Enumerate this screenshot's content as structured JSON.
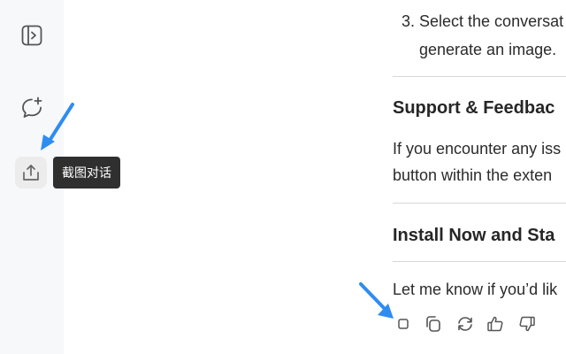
{
  "sidebar": {
    "items": [
      {
        "icon": "sidebar-toggle-icon"
      },
      {
        "icon": "new-chat-icon"
      },
      {
        "icon": "share-upload-icon",
        "active": true
      }
    ]
  },
  "tooltip": {
    "text": "截图对话"
  },
  "content": {
    "step": {
      "number": "3.",
      "line1": "Select the conversat",
      "line2": "generate an image."
    },
    "support": {
      "heading": "Support & Feedbac",
      "line1": "If you encounter any iss",
      "line2": "button within the exten"
    },
    "install": {
      "heading": "Install Now and Sta"
    },
    "closing": {
      "text": "Let me know if you’d lik"
    }
  },
  "actions": [
    {
      "icon": "stop-icon"
    },
    {
      "icon": "copy-icon"
    },
    {
      "icon": "regenerate-icon"
    },
    {
      "icon": "thumbs-up-icon"
    },
    {
      "icon": "thumbs-down-icon"
    }
  ],
  "colors": {
    "sidebar_bg": "#f7f8fa",
    "tooltip_bg": "#2f2f2f",
    "arrow": "#2f8cf0",
    "divider": "#d7d7d7"
  }
}
